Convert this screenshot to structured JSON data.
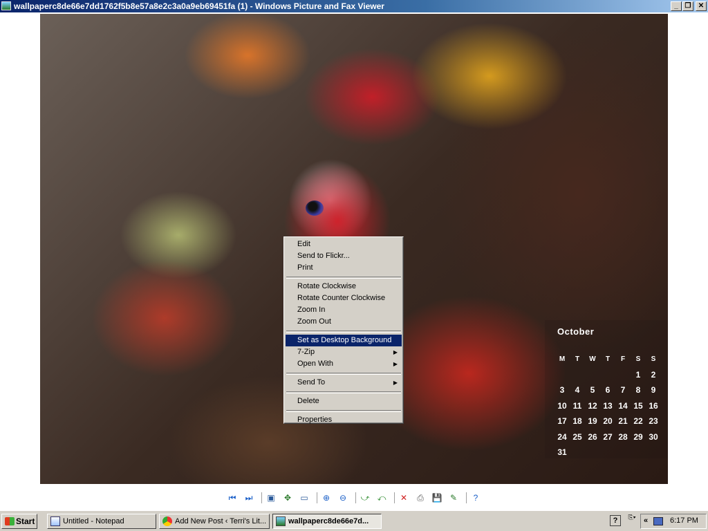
{
  "window": {
    "title": "wallpaperc8de66e7dd1762f5b8e57a8e2c3a0a9eb69451fa (1) - Windows Picture and Fax Viewer",
    "controls": {
      "minimize": "_",
      "maximize": "❐",
      "close": "✕"
    }
  },
  "calendar": {
    "month": "October",
    "weekdays": [
      "M",
      "T",
      "W",
      "T",
      "F",
      "S",
      "S"
    ],
    "weeks": [
      [
        "",
        "",
        "",
        "",
        "",
        "1",
        "2"
      ],
      [
        "3",
        "4",
        "5",
        "6",
        "7",
        "8",
        "9"
      ],
      [
        "10",
        "11",
        "12",
        "13",
        "14",
        "15",
        "16"
      ],
      [
        "17",
        "18",
        "19",
        "20",
        "21",
        "22",
        "23"
      ],
      [
        "24",
        "25",
        "26",
        "27",
        "28",
        "29",
        "30"
      ],
      [
        "31",
        "",
        "",
        "",
        "",
        "",
        ""
      ]
    ]
  },
  "context_menu": {
    "groups": [
      [
        {
          "label": "Edit"
        },
        {
          "label": "Send to Flickr..."
        },
        {
          "label": "Print"
        }
      ],
      [
        {
          "label": "Rotate Clockwise"
        },
        {
          "label": "Rotate Counter Clockwise"
        },
        {
          "label": "Zoom In"
        },
        {
          "label": "Zoom Out"
        }
      ],
      [
        {
          "label": "Set as Desktop Background",
          "selected": true
        },
        {
          "label": "7-Zip",
          "submenu": true
        },
        {
          "label": "Open With",
          "submenu": true
        }
      ],
      [
        {
          "label": "Send To",
          "submenu": true
        }
      ],
      [
        {
          "label": "Delete"
        }
      ],
      [
        {
          "label": "Properties"
        }
      ]
    ]
  },
  "toolbar": {
    "buttons": [
      {
        "name": "previous-image",
        "glyph": "⏮",
        "color": "#1a5fc8"
      },
      {
        "name": "next-image",
        "glyph": "⏭",
        "color": "#1a5fc8"
      },
      {
        "sep": true
      },
      {
        "name": "best-fit",
        "glyph": "▣",
        "color": "#2a5a9a"
      },
      {
        "name": "actual-size",
        "glyph": "✥",
        "color": "#2a7a2a"
      },
      {
        "name": "slide-show",
        "glyph": "▭",
        "color": "#2a5a9a"
      },
      {
        "sep": true
      },
      {
        "name": "zoom-in",
        "glyph": "⊕",
        "color": "#1a5fc8"
      },
      {
        "name": "zoom-out",
        "glyph": "⊖",
        "color": "#1a5fc8"
      },
      {
        "sep": true
      },
      {
        "name": "rotate-clockwise",
        "glyph": "⤻",
        "color": "#2a8a2a"
      },
      {
        "name": "rotate-counterclockwise",
        "glyph": "⤺",
        "color": "#2a8a2a"
      },
      {
        "sep": true
      },
      {
        "name": "delete",
        "glyph": "✕",
        "color": "#d02020"
      },
      {
        "name": "print",
        "glyph": "⎙",
        "color": "#555555"
      },
      {
        "name": "save-copy",
        "glyph": "💾",
        "color": "#1a3a8a"
      },
      {
        "name": "edit-image",
        "glyph": "✎",
        "color": "#2a7a2a"
      },
      {
        "sep": true
      },
      {
        "name": "help",
        "glyph": "?",
        "color": "#1a5fc8"
      }
    ]
  },
  "taskbar": {
    "start_label": "Start",
    "tasks": [
      {
        "label": "Untitled - Notepad"
      },
      {
        "label": "Add New Post ‹ Terri's Lit..."
      },
      {
        "label": "wallpaperc8de66e7d..."
      }
    ],
    "help_glyph": "?",
    "lang_glyph": "⎘▾",
    "tray_expand": "«",
    "clock": "6:17 PM"
  }
}
